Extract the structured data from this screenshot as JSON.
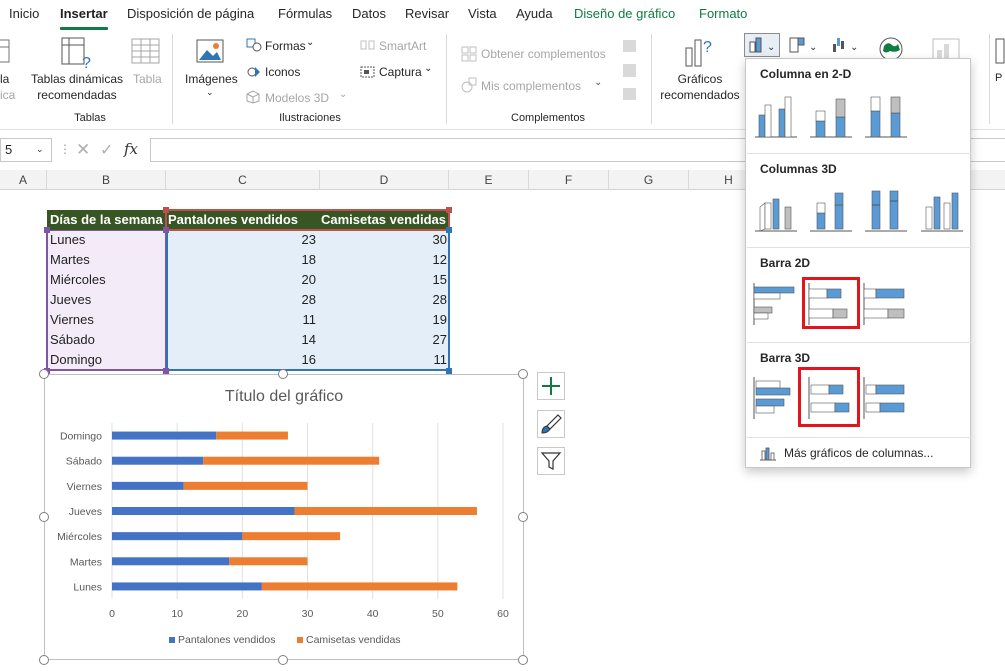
{
  "tabs": [
    {
      "label": "Inicio",
      "state": "normal"
    },
    {
      "label": "Insertar",
      "state": "active"
    },
    {
      "label": "Disposición de página",
      "state": "normal"
    },
    {
      "label": "Fórmulas",
      "state": "normal"
    },
    {
      "label": "Datos",
      "state": "normal"
    },
    {
      "label": "Revisar",
      "state": "normal"
    },
    {
      "label": "Vista",
      "state": "normal"
    },
    {
      "label": "Ayuda",
      "state": "normal"
    },
    {
      "label": "Diseño de gráfico",
      "state": "context"
    },
    {
      "label": "Formato",
      "state": "context"
    }
  ],
  "ribbon": {
    "tablas": {
      "partial_top": "la",
      "partial_bottom": "ica",
      "pivot_line1": "Tablas dinámicas",
      "pivot_line2": "recomendadas",
      "table_label": "Tabla",
      "group_label": "Tablas"
    },
    "ilustraciones": {
      "imagenes": "Imágenes",
      "formas": "Formas",
      "iconos": "Iconos",
      "modelos3d": "Modelos 3D",
      "smartart": "SmartArt",
      "captura": "Captura",
      "group_label": "Ilustraciones"
    },
    "complementos": {
      "obtener": "Obtener complementos",
      "mis": "Mis complementos",
      "group_label": "Complementos"
    },
    "graficos": {
      "rec_line1": "Gráficos",
      "rec_line2": "recomendados"
    },
    "right_partial": "P"
  },
  "formula_bar": {
    "name_box": "5",
    "fx": "fx",
    "value": ""
  },
  "columns": [
    "A",
    "B",
    "C",
    "D",
    "E",
    "F",
    "G",
    "H"
  ],
  "table": {
    "headers": [
      "Días de la semana",
      "Pantalones vendidos",
      "Camisetas vendidas"
    ],
    "rows": [
      {
        "day": "Lunes",
        "pants": 23,
        "shirts": 30
      },
      {
        "day": "Martes",
        "pants": 18,
        "shirts": 12
      },
      {
        "day": "Miércoles",
        "pants": 20,
        "shirts": 15
      },
      {
        "day": "Jueves",
        "pants": 28,
        "shirts": 28
      },
      {
        "day": "Viernes",
        "pants": 11,
        "shirts": 19
      },
      {
        "day": "Sábado",
        "pants": 14,
        "shirts": 27
      },
      {
        "day": "Domingo",
        "pants": 16,
        "shirts": 11
      }
    ]
  },
  "chart_data": {
    "type": "bar",
    "orientation": "horizontal",
    "stacked": true,
    "title": "Título del gráfico",
    "categories": [
      "Lunes",
      "Martes",
      "Miércoles",
      "Jueves",
      "Viernes",
      "Sábado",
      "Domingo"
    ],
    "series": [
      {
        "name": "Pantalones vendidos",
        "values": [
          23,
          18,
          20,
          28,
          11,
          14,
          16
        ],
        "color": "#4472c4"
      },
      {
        "name": "Camisetas vendidas",
        "values": [
          30,
          12,
          15,
          28,
          19,
          27,
          11
        ],
        "color": "#ed7d31"
      }
    ],
    "xlim": [
      0,
      60
    ],
    "xticks": [
      0,
      10,
      20,
      30,
      40,
      50,
      60
    ],
    "grid": true,
    "legend": "bottom"
  },
  "gallery": {
    "sections": [
      {
        "title": "Columna en 2-D"
      },
      {
        "title": "Columnas 3D"
      },
      {
        "title": "Barra 2D"
      },
      {
        "title": "Barra 3D"
      }
    ],
    "more_link": "Más gráficos de columnas...",
    "highlight_color": "#e3141b"
  },
  "colors": {
    "accent_green": "#107c41",
    "table_header": "#375623",
    "series1": "#4472c4",
    "series2": "#ed7d31"
  }
}
